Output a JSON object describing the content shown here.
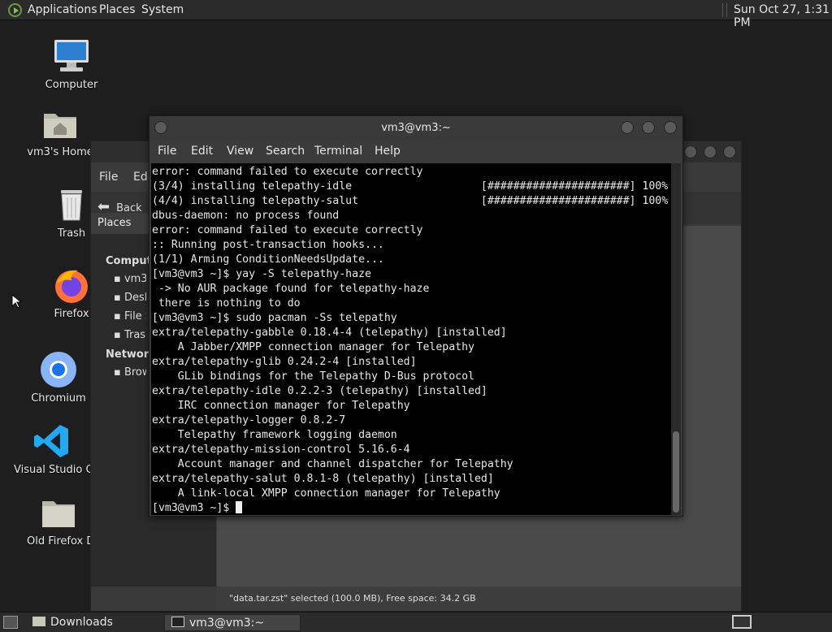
{
  "topbar": {
    "applications": "Applications",
    "places": "Places",
    "system": "System",
    "clock": "Sun Oct 27,  1:31 PM"
  },
  "desktop": {
    "icons": [
      {
        "label": "Computer"
      },
      {
        "label": "vm3's Home"
      },
      {
        "label": "Trash"
      },
      {
        "label": "Firefox"
      },
      {
        "label": "Chromium"
      },
      {
        "label": "Visual Studio Code"
      },
      {
        "label": "Old Firefox Data"
      }
    ]
  },
  "filemanager": {
    "menu": [
      "File",
      "Edit"
    ],
    "back": "Back",
    "places_label": "Places",
    "sidebar": {
      "computer_header": "Computer",
      "items": [
        "vm3",
        "Desktop",
        "File System",
        "Trash"
      ],
      "network_header": "Network",
      "network_items": [
        "Browse Network"
      ]
    },
    "status": "\"data.tar.zst\" selected (100.0 MB), Free space: 34.2 GB"
  },
  "terminal": {
    "title": "vm3@vm3:~",
    "menu": [
      "File",
      "Edit",
      "View",
      "Search",
      "Terminal",
      "Help"
    ],
    "lines": [
      "error: command failed to execute correctly",
      "(3/4) installing telepathy-idle                    [######################] 100%",
      "(4/4) installing telepathy-salut                   [######################] 100%",
      "dbus-daemon: no process found",
      "error: command failed to execute correctly",
      ":: Running post-transaction hooks...",
      "(1/1) Arming ConditionNeedsUpdate...",
      "[vm3@vm3 ~]$ yay -S telepathy-haze",
      " -> No AUR package found for telepathy-haze",
      " there is nothing to do",
      "[vm3@vm3 ~]$ sudo pacman -Ss telepathy",
      "extra/telepathy-gabble 0.18.4-4 (telepathy) [installed]",
      "    A Jabber/XMPP connection manager for Telepathy",
      "extra/telepathy-glib 0.24.2-4 [installed]",
      "    GLib bindings for the Telepathy D-Bus protocol",
      "extra/telepathy-idle 0.2.2-3 (telepathy) [installed]",
      "    IRC connection manager for Telepathy",
      "extra/telepathy-logger 0.8.2-7",
      "    Telepathy framework logging daemon",
      "extra/telepathy-mission-control 5.16.6-4",
      "    Account manager and channel dispatcher for Telepathy",
      "extra/telepathy-salut 0.8.1-8 (telepathy) [installed]",
      "    A link-local XMPP connection manager for Telepathy"
    ],
    "prompt": "[vm3@vm3 ~]$ "
  },
  "taskbar": {
    "tasks": [
      "Downloads",
      "vm3@vm3:~"
    ]
  }
}
